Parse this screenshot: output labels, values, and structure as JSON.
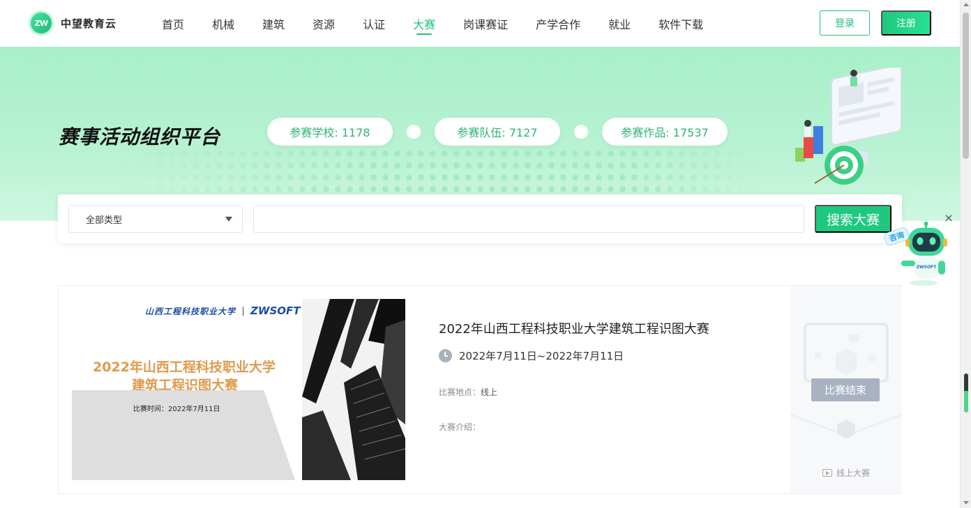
{
  "header": {
    "logo_badge": "ZW",
    "logo_text": "中望教育云",
    "nav": [
      {
        "label": "首页"
      },
      {
        "label": "机械"
      },
      {
        "label": "建筑"
      },
      {
        "label": "资源"
      },
      {
        "label": "认证"
      },
      {
        "label": "大赛",
        "active": true
      },
      {
        "label": "岗课赛证"
      },
      {
        "label": "产学合作"
      },
      {
        "label": "就业"
      },
      {
        "label": "软件下载"
      }
    ],
    "login_label": "登录",
    "register_label": "注册"
  },
  "banner": {
    "title": "赛事活动组织平台",
    "stats": {
      "schools": "参赛学校: 1178",
      "teams": "参赛队伍: 7127",
      "works": "参赛作品: 17537"
    }
  },
  "search": {
    "type_selected": "全部类型",
    "input_value": "",
    "button_label": "搜索大赛"
  },
  "consult": {
    "label": "咨询",
    "robot_text": "ZWSOFT",
    "close_glyph": "×"
  },
  "competition": {
    "poster": {
      "logo_cn": "山西工程科技职业大学",
      "logo_en": "ZWSOFT",
      "title_line1": "2022年山西工程科技职业大学",
      "title_line2": "建筑工程识图大赛",
      "date_text": "比赛时间：2022年7月11日"
    },
    "title": "2022年山西工程科技职业大学建筑工程识图大赛",
    "time": "2022年7月11日~2022年7月11日",
    "location_label": "比赛地点：",
    "location_value": "线上",
    "intro_label": "大赛介绍：",
    "intro_value": "",
    "status": "比赛结束",
    "mode": "线上大赛"
  },
  "colors": {
    "brand": "#1fbf7a",
    "banner_bg": "#b8f2d3",
    "status_badge": "#a8b2c0"
  }
}
